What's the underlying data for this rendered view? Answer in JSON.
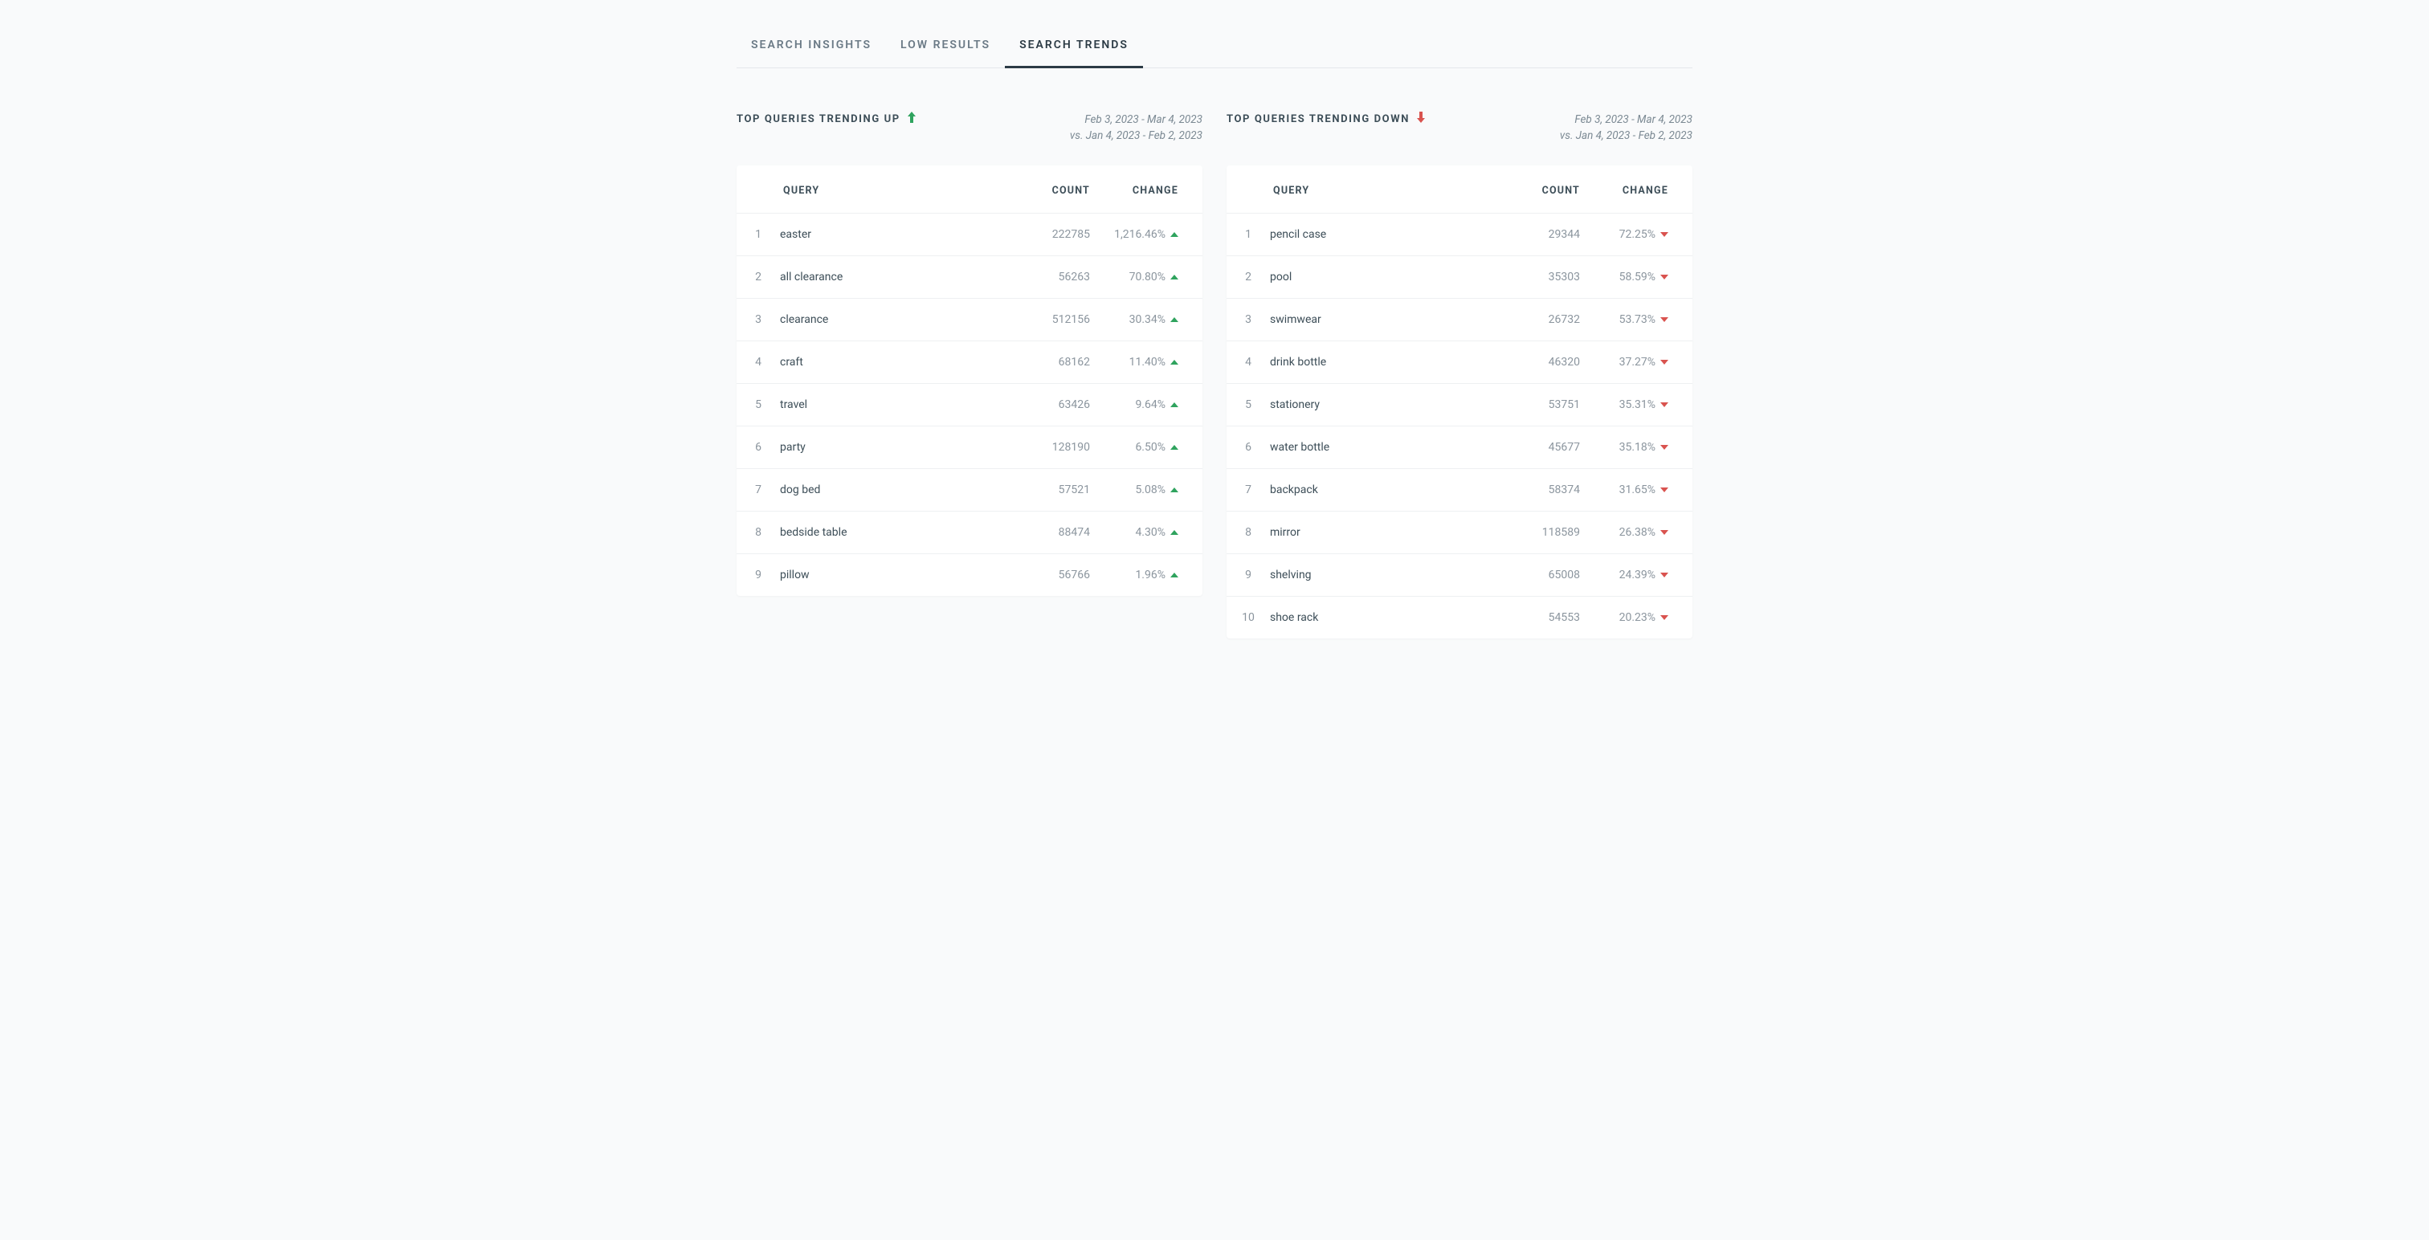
{
  "tabs": [
    "SEARCH INSIGHTS",
    "LOW RESULTS",
    "SEARCH TRENDS"
  ],
  "active_tab": 2,
  "date_range": {
    "line1": "Feb 3, 2023 - Mar 4, 2023",
    "line2": "vs. Jan 4, 2023 - Feb 2, 2023"
  },
  "columns": {
    "query": "QUERY",
    "count": "COUNT",
    "change": "CHANGE"
  },
  "up": {
    "title": "TOP QUERIES TRENDING UP",
    "rows": [
      {
        "i": "1",
        "q": "easter",
        "c": "222785",
        "ch": "1,216.46%"
      },
      {
        "i": "2",
        "q": "all clearance",
        "c": "56263",
        "ch": "70.80%"
      },
      {
        "i": "3",
        "q": "clearance",
        "c": "512156",
        "ch": "30.34%"
      },
      {
        "i": "4",
        "q": "craft",
        "c": "68162",
        "ch": "11.40%"
      },
      {
        "i": "5",
        "q": "travel",
        "c": "63426",
        "ch": "9.64%"
      },
      {
        "i": "6",
        "q": "party",
        "c": "128190",
        "ch": "6.50%"
      },
      {
        "i": "7",
        "q": "dog bed",
        "c": "57521",
        "ch": "5.08%"
      },
      {
        "i": "8",
        "q": "bedside table",
        "c": "88474",
        "ch": "4.30%"
      },
      {
        "i": "9",
        "q": "pillow",
        "c": "56766",
        "ch": "1.96%"
      }
    ]
  },
  "down": {
    "title": "TOP QUERIES TRENDING DOWN",
    "rows": [
      {
        "i": "1",
        "q": "pencil case",
        "c": "29344",
        "ch": "72.25%"
      },
      {
        "i": "2",
        "q": "pool",
        "c": "35303",
        "ch": "58.59%"
      },
      {
        "i": "3",
        "q": "swimwear",
        "c": "26732",
        "ch": "53.73%"
      },
      {
        "i": "4",
        "q": "drink bottle",
        "c": "46320",
        "ch": "37.27%"
      },
      {
        "i": "5",
        "q": "stationery",
        "c": "53751",
        "ch": "35.31%"
      },
      {
        "i": "6",
        "q": "water bottle",
        "c": "45677",
        "ch": "35.18%"
      },
      {
        "i": "7",
        "q": "backpack",
        "c": "58374",
        "ch": "31.65%"
      },
      {
        "i": "8",
        "q": "mirror",
        "c": "118589",
        "ch": "26.38%"
      },
      {
        "i": "9",
        "q": "shelving",
        "c": "65008",
        "ch": "24.39%"
      },
      {
        "i": "10",
        "q": "shoe rack",
        "c": "54553",
        "ch": "20.23%"
      }
    ]
  }
}
